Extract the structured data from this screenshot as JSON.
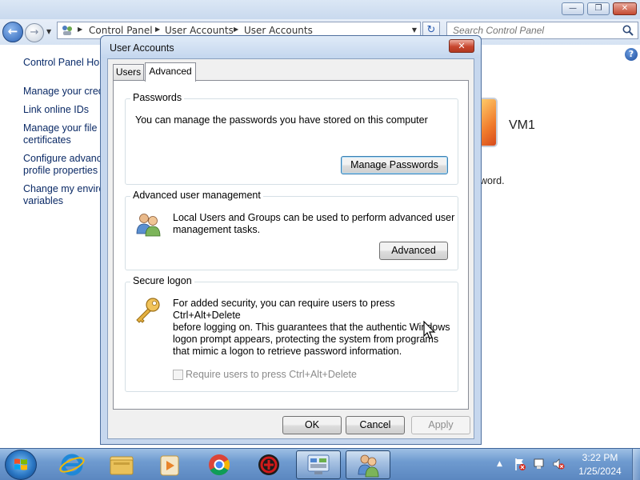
{
  "explorer": {
    "breadcrumbs": [
      "Control Panel",
      "User Accounts",
      "User Accounts"
    ],
    "search_placeholder": "Search Control Panel",
    "sidebar": {
      "home": "Control Panel Hom",
      "links": [
        [
          "Manage your cred"
        ],
        [
          "Link online IDs"
        ],
        [
          "Manage your file e",
          "certificates"
        ],
        [
          "Configure advanc",
          "profile properties"
        ],
        [
          "Change my enviro",
          "variables"
        ]
      ]
    },
    "account_name": "VM1",
    "partial_text": "word."
  },
  "dialog": {
    "title": "User Accounts",
    "tabs": [
      "Users",
      "Advanced"
    ],
    "active_tab": "Advanced",
    "passwords": {
      "label": "Passwords",
      "text": "You can manage the passwords you have stored on this computer",
      "button": "Manage Passwords"
    },
    "advanced_user_management": {
      "label": "Advanced user management",
      "text_lines": [
        "Local Users and Groups can be used to perform advanced user",
        "management tasks."
      ],
      "button": "Advanced"
    },
    "secure_logon": {
      "label": "Secure logon",
      "text_lines": [
        "For added security, you can require users to press Ctrl+Alt+Delete",
        "before logging on. This guarantees that the authentic Windows",
        "logon prompt appears, protecting the system from programs",
        "that mimic a logon to retrieve password information."
      ],
      "checkbox_label": "Require users to press Ctrl+Alt+Delete",
      "checkbox_checked": false,
      "checkbox_enabled": false
    },
    "buttons": {
      "ok": "OK",
      "cancel": "Cancel",
      "apply": "Apply"
    }
  },
  "taskbar": {
    "apps": [
      "internet-explorer",
      "windows-explorer",
      "media-player",
      "chrome",
      "game-app",
      "control-panel",
      "user-accounts"
    ],
    "time": "3:22 PM",
    "date": "1/25/2024"
  },
  "colors": {
    "accent": "#2b77c4",
    "taskbar": "#6f9bd0",
    "dialog_frame": "#c6d7ee"
  }
}
